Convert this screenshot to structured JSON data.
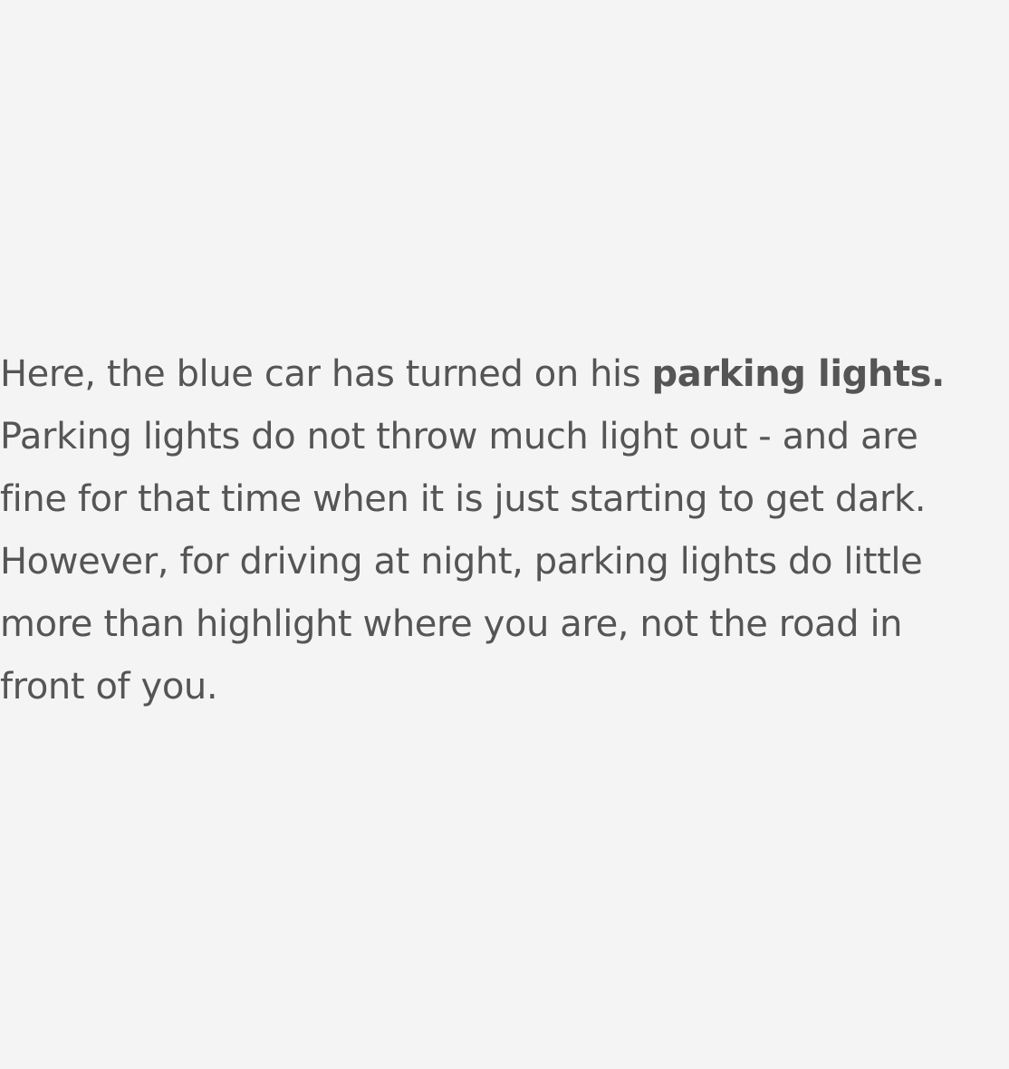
{
  "paragraph": {
    "line1_text": "Here, the blue car has turned on his ",
    "line1_bold": "parking lights.",
    "line2": "Parking lights do not throw much light out - and are",
    "line3": "fine for that time when it is just starting to get dark.",
    "line4": "However, for driving at night, parking lights do little",
    "line5": "more than highlight where you are, not the road in",
    "line6": "front of you."
  },
  "colors": {
    "background": "#f4f4f4",
    "text": "#555555"
  }
}
